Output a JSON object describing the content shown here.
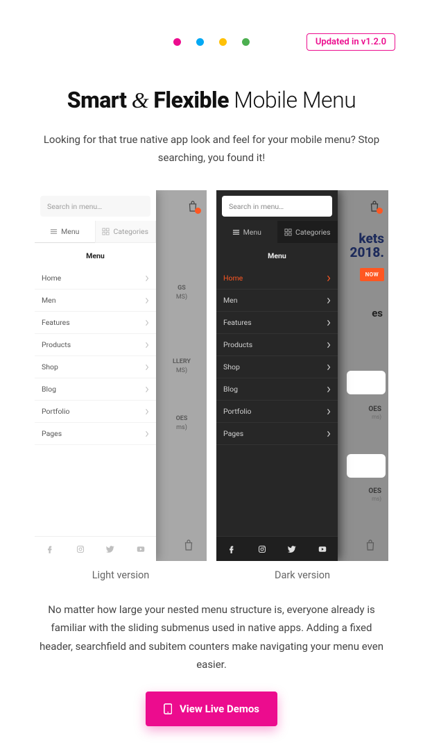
{
  "topbar": {
    "update_label": "Updated in v1.2.0"
  },
  "heading": {
    "part1": "Smart",
    "amp": "&",
    "part2": "Flexible",
    "rest": "Mobile Menu"
  },
  "subtitle": "Looking for that true native app look and feel for your mobile menu? Stop searching, you found it!",
  "light": {
    "search_placeholder": "Search in menu…",
    "tab_menu": "Menu",
    "tab_categories": "Categories",
    "menu_title": "Menu",
    "items": [
      {
        "label": "Home"
      },
      {
        "label": "Men"
      },
      {
        "label": "Features"
      },
      {
        "label": "Products"
      },
      {
        "label": "Shop"
      },
      {
        "label": "Blog"
      },
      {
        "label": "Portfolio"
      },
      {
        "label": "Pages"
      }
    ],
    "label": "Light version",
    "bg": {
      "tile1": "GS",
      "tile1b": "MS)",
      "tile2": "LLERY",
      "tile2b": "MS)",
      "tile3": "OES",
      "tile3b": "ms)"
    }
  },
  "dark": {
    "search_placeholder": "Search in menu…",
    "tab_menu": "Menu",
    "tab_categories": "Categories",
    "menu_title": "Menu",
    "items": [
      {
        "label": "Home",
        "active": true
      },
      {
        "label": "Men"
      },
      {
        "label": "Features"
      },
      {
        "label": "Products"
      },
      {
        "label": "Shop"
      },
      {
        "label": "Blog"
      },
      {
        "label": "Portfolio"
      },
      {
        "label": "Pages"
      }
    ],
    "label": "Dark version",
    "bg": {
      "headline1": "kets",
      "headline2": "2018.",
      "button": "NOW",
      "es": "es",
      "oes": "OES",
      "ms": "ms)"
    }
  },
  "bottom": "No matter how large your nested menu structure is, everyone already is familiar with the sliding submenus used in native apps. Adding a fixed header, searchfield and subitem counters make navigating your menu even easier.",
  "cta": {
    "label": "View Live Demos"
  },
  "colors": {
    "brand": "#ec0c8e",
    "accent": "#ff5722"
  }
}
